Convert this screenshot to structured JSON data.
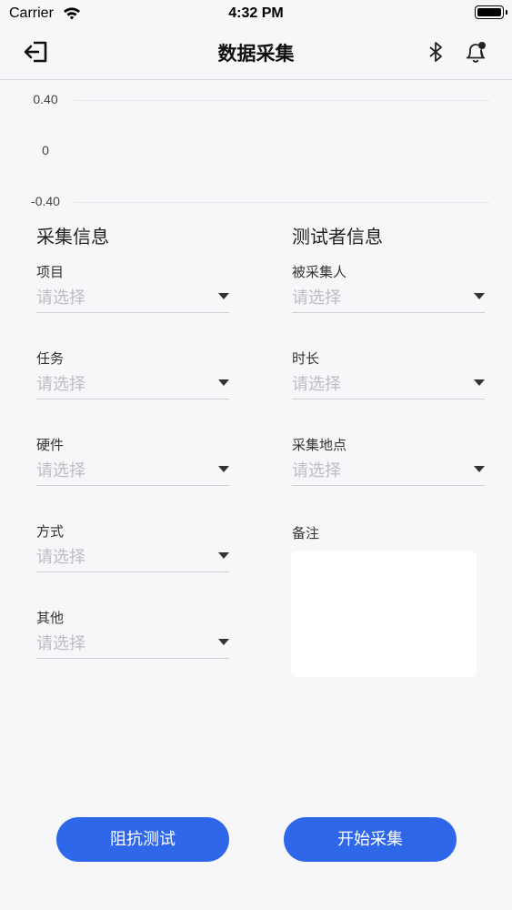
{
  "status": {
    "carrier": "Carrier",
    "time": "4:32 PM"
  },
  "nav": {
    "title": "数据采集",
    "icons": [
      "exit-icon",
      "bluetooth-icon",
      "bell-notification-icon"
    ]
  },
  "chart_data": {
    "type": "line",
    "yticks": [
      "0.40",
      "0",
      "-0.40"
    ],
    "ylim": [
      -0.4,
      0.4
    ],
    "series": []
  },
  "collection": {
    "title": "采集信息",
    "fields": [
      {
        "label": "项目",
        "placeholder": "请选择"
      },
      {
        "label": "任务",
        "placeholder": "请选择"
      },
      {
        "label": "硬件",
        "placeholder": "请选择"
      },
      {
        "label": "方式",
        "placeholder": "请选择"
      },
      {
        "label": "其他",
        "placeholder": "请选择"
      }
    ]
  },
  "tester": {
    "title": "测试者信息",
    "fields": [
      {
        "label": "被采集人",
        "placeholder": "请选择"
      },
      {
        "label": "时长",
        "placeholder": "请选择"
      },
      {
        "label": "采集地点",
        "placeholder": "请选择"
      }
    ],
    "note_label": "备注"
  },
  "actions": {
    "impedance_label": "阻抗测试",
    "start_label": "开始采集"
  },
  "colors": {
    "accent": "#2f67ea",
    "placeholder": "#bdbdc2"
  }
}
